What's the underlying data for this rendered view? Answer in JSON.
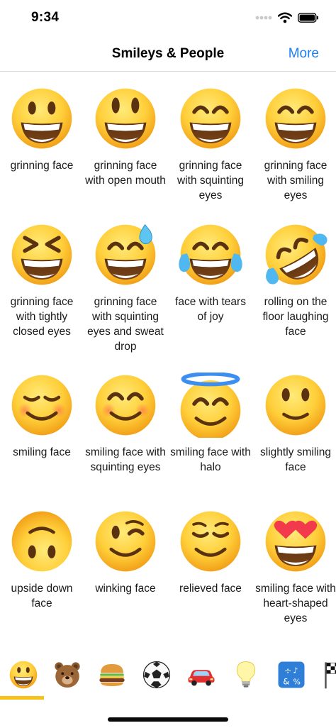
{
  "status": {
    "time": "9:34"
  },
  "nav": {
    "title": "Smileys & People",
    "more_label": "More"
  },
  "emojis": [
    {
      "label": "grinning face",
      "kind": "grin"
    },
    {
      "label": "grinning face with open mouth",
      "kind": "grin-open"
    },
    {
      "label": "grinning face with squinting eyes",
      "kind": "grin-squint"
    },
    {
      "label": "grinning face with smiling eyes",
      "kind": "grin-smile-eyes"
    },
    {
      "label": "grinning face with tightly closed eyes",
      "kind": "xd"
    },
    {
      "label": "grinning face with squinting eyes and sweat drop",
      "kind": "sweat"
    },
    {
      "label": "face with tears of joy",
      "kind": "joy"
    },
    {
      "label": "rolling on the floor laughing face",
      "kind": "rofl"
    },
    {
      "label": "smiling face",
      "kind": "smiling"
    },
    {
      "label": "smiling face with squinting eyes",
      "kind": "blush"
    },
    {
      "label": "smiling face with halo",
      "kind": "halo"
    },
    {
      "label": "slightly smiling face",
      "kind": "slight"
    },
    {
      "label": "upside down face",
      "kind": "upside"
    },
    {
      "label": "winking face",
      "kind": "wink"
    },
    {
      "label": "relieved face",
      "kind": "relieved"
    },
    {
      "label": "smiling face with heart-shaped eyes",
      "kind": "hearts"
    }
  ],
  "tabs": [
    {
      "name": "smileys-people",
      "icon": "smiley-icon",
      "selected": true
    },
    {
      "name": "animals-nature",
      "icon": "bear-icon",
      "selected": false
    },
    {
      "name": "food-drink",
      "icon": "burger-icon",
      "selected": false
    },
    {
      "name": "activity",
      "icon": "soccer-ball-icon",
      "selected": false
    },
    {
      "name": "travel-places",
      "icon": "car-icon",
      "selected": false
    },
    {
      "name": "objects",
      "icon": "lightbulb-icon",
      "selected": false
    },
    {
      "name": "symbols",
      "icon": "symbols-icon",
      "selected": false
    },
    {
      "name": "flags",
      "icon": "flag-icon",
      "selected": false
    }
  ],
  "colors": {
    "accent": "#1a7ff0",
    "face_light": "#ffdd55",
    "face_dark": "#f6a81c",
    "tab_indicator": "#f7c21a"
  }
}
